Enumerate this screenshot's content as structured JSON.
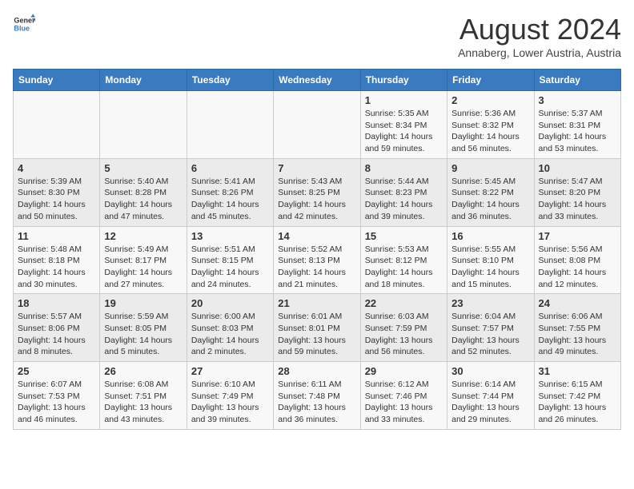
{
  "header": {
    "logo_line1": "General",
    "logo_line2": "Blue",
    "main_title": "August 2024",
    "subtitle": "Annaberg, Lower Austria, Austria"
  },
  "calendar": {
    "days_of_week": [
      "Sunday",
      "Monday",
      "Tuesday",
      "Wednesday",
      "Thursday",
      "Friday",
      "Saturday"
    ],
    "weeks": [
      [
        {
          "day": "",
          "info": ""
        },
        {
          "day": "",
          "info": ""
        },
        {
          "day": "",
          "info": ""
        },
        {
          "day": "",
          "info": ""
        },
        {
          "day": "1",
          "info": "Sunrise: 5:35 AM\nSunset: 8:34 PM\nDaylight: 14 hours\nand 59 minutes."
        },
        {
          "day": "2",
          "info": "Sunrise: 5:36 AM\nSunset: 8:32 PM\nDaylight: 14 hours\nand 56 minutes."
        },
        {
          "day": "3",
          "info": "Sunrise: 5:37 AM\nSunset: 8:31 PM\nDaylight: 14 hours\nand 53 minutes."
        }
      ],
      [
        {
          "day": "4",
          "info": "Sunrise: 5:39 AM\nSunset: 8:30 PM\nDaylight: 14 hours\nand 50 minutes."
        },
        {
          "day": "5",
          "info": "Sunrise: 5:40 AM\nSunset: 8:28 PM\nDaylight: 14 hours\nand 47 minutes."
        },
        {
          "day": "6",
          "info": "Sunrise: 5:41 AM\nSunset: 8:26 PM\nDaylight: 14 hours\nand 45 minutes."
        },
        {
          "day": "7",
          "info": "Sunrise: 5:43 AM\nSunset: 8:25 PM\nDaylight: 14 hours\nand 42 minutes."
        },
        {
          "day": "8",
          "info": "Sunrise: 5:44 AM\nSunset: 8:23 PM\nDaylight: 14 hours\nand 39 minutes."
        },
        {
          "day": "9",
          "info": "Sunrise: 5:45 AM\nSunset: 8:22 PM\nDaylight: 14 hours\nand 36 minutes."
        },
        {
          "day": "10",
          "info": "Sunrise: 5:47 AM\nSunset: 8:20 PM\nDaylight: 14 hours\nand 33 minutes."
        }
      ],
      [
        {
          "day": "11",
          "info": "Sunrise: 5:48 AM\nSunset: 8:18 PM\nDaylight: 14 hours\nand 30 minutes."
        },
        {
          "day": "12",
          "info": "Sunrise: 5:49 AM\nSunset: 8:17 PM\nDaylight: 14 hours\nand 27 minutes."
        },
        {
          "day": "13",
          "info": "Sunrise: 5:51 AM\nSunset: 8:15 PM\nDaylight: 14 hours\nand 24 minutes."
        },
        {
          "day": "14",
          "info": "Sunrise: 5:52 AM\nSunset: 8:13 PM\nDaylight: 14 hours\nand 21 minutes."
        },
        {
          "day": "15",
          "info": "Sunrise: 5:53 AM\nSunset: 8:12 PM\nDaylight: 14 hours\nand 18 minutes."
        },
        {
          "day": "16",
          "info": "Sunrise: 5:55 AM\nSunset: 8:10 PM\nDaylight: 14 hours\nand 15 minutes."
        },
        {
          "day": "17",
          "info": "Sunrise: 5:56 AM\nSunset: 8:08 PM\nDaylight: 14 hours\nand 12 minutes."
        }
      ],
      [
        {
          "day": "18",
          "info": "Sunrise: 5:57 AM\nSunset: 8:06 PM\nDaylight: 14 hours\nand 8 minutes."
        },
        {
          "day": "19",
          "info": "Sunrise: 5:59 AM\nSunset: 8:05 PM\nDaylight: 14 hours\nand 5 minutes."
        },
        {
          "day": "20",
          "info": "Sunrise: 6:00 AM\nSunset: 8:03 PM\nDaylight: 14 hours\nand 2 minutes."
        },
        {
          "day": "21",
          "info": "Sunrise: 6:01 AM\nSunset: 8:01 PM\nDaylight: 13 hours\nand 59 minutes."
        },
        {
          "day": "22",
          "info": "Sunrise: 6:03 AM\nSunset: 7:59 PM\nDaylight: 13 hours\nand 56 minutes."
        },
        {
          "day": "23",
          "info": "Sunrise: 6:04 AM\nSunset: 7:57 PM\nDaylight: 13 hours\nand 52 minutes."
        },
        {
          "day": "24",
          "info": "Sunrise: 6:06 AM\nSunset: 7:55 PM\nDaylight: 13 hours\nand 49 minutes."
        }
      ],
      [
        {
          "day": "25",
          "info": "Sunrise: 6:07 AM\nSunset: 7:53 PM\nDaylight: 13 hours\nand 46 minutes."
        },
        {
          "day": "26",
          "info": "Sunrise: 6:08 AM\nSunset: 7:51 PM\nDaylight: 13 hours\nand 43 minutes."
        },
        {
          "day": "27",
          "info": "Sunrise: 6:10 AM\nSunset: 7:49 PM\nDaylight: 13 hours\nand 39 minutes."
        },
        {
          "day": "28",
          "info": "Sunrise: 6:11 AM\nSunset: 7:48 PM\nDaylight: 13 hours\nand 36 minutes."
        },
        {
          "day": "29",
          "info": "Sunrise: 6:12 AM\nSunset: 7:46 PM\nDaylight: 13 hours\nand 33 minutes."
        },
        {
          "day": "30",
          "info": "Sunrise: 6:14 AM\nSunset: 7:44 PM\nDaylight: 13 hours\nand 29 minutes."
        },
        {
          "day": "31",
          "info": "Sunrise: 6:15 AM\nSunset: 7:42 PM\nDaylight: 13 hours\nand 26 minutes."
        }
      ]
    ]
  }
}
